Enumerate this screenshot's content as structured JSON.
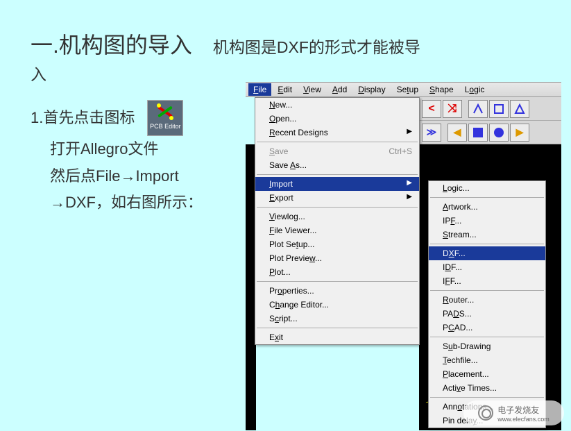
{
  "title": "一.机构图的导入",
  "subtitle": "机构图是DXF的形式才能被导",
  "subtitle_wrap": "入",
  "step1_line1": "1.首先点击图标",
  "icon_label": "PCB Editor",
  "step1_line2": "打开Allegro文件",
  "step1_line3": "然后点File→Import",
  "step1_line4": "→DXF，如右图所示：",
  "menubar": {
    "file": "File",
    "edit": "Edit",
    "view": "View",
    "add": "Add",
    "display": "Display",
    "setup": "Setup",
    "shape": "Shape",
    "logic": "Logic"
  },
  "file_menu": {
    "new": "New...",
    "open": "Open...",
    "recent": "Recent Designs",
    "save": "Save",
    "save_shortcut": "Ctrl+S",
    "save_as": "Save As...",
    "import": "Import",
    "export": "Export",
    "viewlog": "Viewlog...",
    "file_viewer": "File Viewer...",
    "plot_setup": "Plot Setup...",
    "plot_preview": "Plot Preview...",
    "plot": "Plot...",
    "properties": "Properties...",
    "change_editor": "Change Editor...",
    "script": "Script...",
    "exit": "Exit"
  },
  "import_submenu": {
    "logic": "Logic...",
    "artwork": "Artwork...",
    "ipf": "IPF...",
    "stream": "Stream...",
    "dxf": "DXF...",
    "idf": "IDF...",
    "iff": "IFF...",
    "router": "Router...",
    "pads": "PADS...",
    "pcad": "PCAD...",
    "sub_drawing": "Sub-Drawing",
    "techfile": "Techfile...",
    "placement": "Placement...",
    "active_times": "Active Times...",
    "annotations": "Annotations...",
    "pin_delay": "Pin delay..."
  },
  "watermark": "电子发烧友",
  "watermark_url": "www.elecfans.com"
}
